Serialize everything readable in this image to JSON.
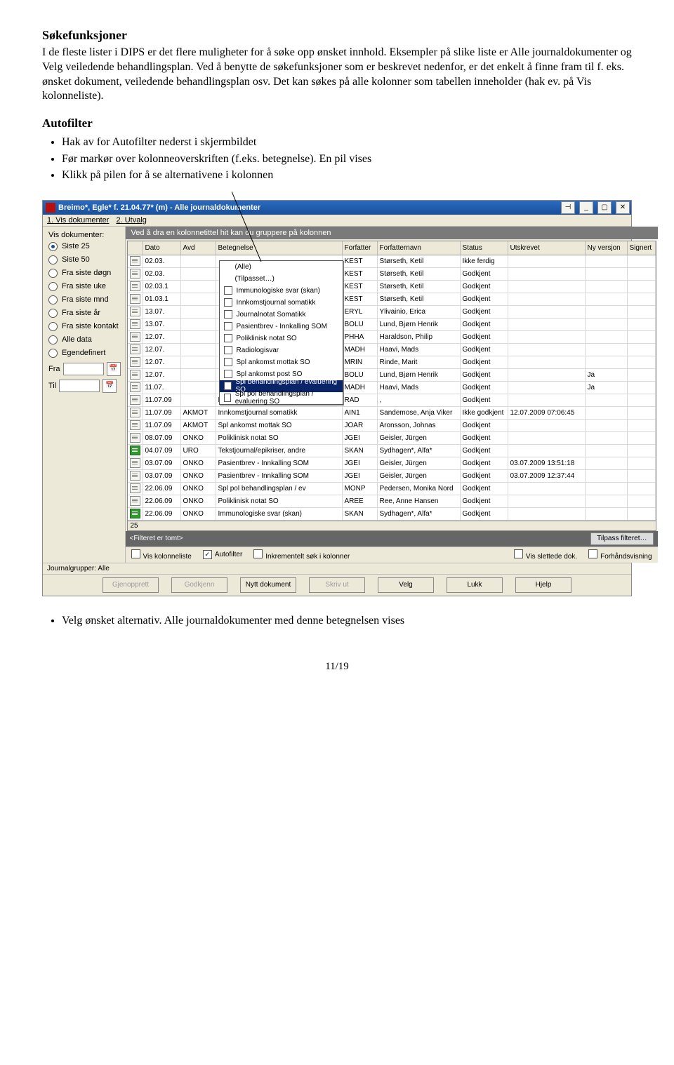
{
  "sec1": {
    "title": "Søkefunksjoner",
    "body": "I de fleste lister i DIPS er det flere muligheter for å søke opp ønsket innhold. Eksempler på slike liste er Alle journaldokumenter og Velg veiledende behandlingsplan. Ved å benytte de søkefunksjoner som er beskrevet nedenfor, er det enkelt å finne fram til f. eks. ønsket dokument, veiledende behandlingsplan osv. Det kan søkes på alle kolonner som tabellen inneholder (hak ev. på Vis kolonneliste)."
  },
  "sec2": {
    "title": "Autofilter",
    "bullets": [
      "Hak av for Autofilter nederst i skjermbildet",
      "Før markør over kolonneoverskriften (f.eks. betegnelse).  En pil vises",
      "Klikk på pilen for å se alternativene i kolonnen"
    ]
  },
  "window": {
    "title": "Breimo*, Egle* f. 21.04.77* (m) - Alle journaldokumenter",
    "strip1": "1. Vis dokumenter",
    "strip2": "2. Utvalg",
    "sidebarTitle": "Vis dokumenter:",
    "radios": [
      "Siste 25",
      "Siste 50",
      "Fra siste døgn",
      "Fra siste uke",
      "Fra siste mnd",
      "Fra siste år",
      "Fra siste kontakt",
      "Alle data",
      "Egendefinert"
    ],
    "fraLabel": "Fra",
    "tilLabel": "Til",
    "groupHint": "Ved å dra en kolonnetittel hit kan du gruppere på kolonnen",
    "columns": [
      "",
      "Dato",
      "Avd",
      "Betegnelse",
      "Forfatter",
      "Forfatternavn",
      "Status",
      "Utskrevet",
      "Ny versjon",
      "Signert"
    ],
    "rows": [
      {
        "ico": "doc",
        "d": "02.03.",
        "a": "",
        "b": "",
        "f": "KEST",
        "fn": "Størseth, Ketil",
        "s": "Ikke ferdig",
        "u": "",
        "nv": "",
        "sg": ""
      },
      {
        "ico": "doc",
        "d": "02.03.",
        "a": "",
        "b": "",
        "f": "KEST",
        "fn": "Størseth, Ketil",
        "s": "Godkjent",
        "u": "",
        "nv": "",
        "sg": ""
      },
      {
        "ico": "doc",
        "d": "02.03.1",
        "a": "",
        "b": "",
        "f": "KEST",
        "fn": "Størseth, Ketil",
        "s": "Godkjent",
        "u": "",
        "nv": "",
        "sg": ""
      },
      {
        "ico": "doc",
        "d": "01.03.1",
        "a": "",
        "b": "",
        "f": "KEST",
        "fn": "Størseth, Ketil",
        "s": "Godkjent",
        "u": "",
        "nv": "",
        "sg": ""
      },
      {
        "ico": "doc",
        "d": "13.07.",
        "a": "",
        "b": "",
        "f": "ERYL",
        "fn": "Ylivainio, Erica",
        "s": "Godkjent",
        "u": "",
        "nv": "",
        "sg": ""
      },
      {
        "ico": "doc",
        "d": "13.07.",
        "a": "",
        "b": "",
        "f": "BOLU",
        "fn": "Lund, Bjørn Henrik",
        "s": "Godkjent",
        "u": "",
        "nv": "",
        "sg": ""
      },
      {
        "ico": "doc",
        "d": "12.07.",
        "a": "",
        "b": "",
        "f": "PHHA",
        "fn": "Haraldson, Philip",
        "s": "Godkjent",
        "u": "",
        "nv": "",
        "sg": ""
      },
      {
        "ico": "doc",
        "d": "12.07.",
        "a": "",
        "b": "",
        "f": "MADH",
        "fn": "Haavi, Mads",
        "s": "Godkjent",
        "u": "",
        "nv": "",
        "sg": ""
      },
      {
        "ico": "doc",
        "d": "12.07.",
        "a": "",
        "b": "",
        "f": "MRIN",
        "fn": "Rinde, Marit",
        "s": "Godkjent",
        "u": "",
        "nv": "",
        "sg": ""
      },
      {
        "ico": "doc",
        "d": "12.07.",
        "a": "",
        "b": "",
        "f": "BOLU",
        "fn": "Lund, Bjørn Henrik",
        "s": "Godkjent",
        "u": "",
        "nv": "Ja",
        "sg": ""
      },
      {
        "ico": "doc",
        "d": "11.07.",
        "a": "",
        "b": "",
        "f": "MADH",
        "fn": "Haavi, Mads",
        "s": "Godkjent",
        "u": "",
        "nv": "Ja",
        "sg": ""
      },
      {
        "ico": "doc",
        "d": "11.07.09",
        "a": "",
        "b": "Radiologisvar",
        "f": "RAD",
        "fn": ",",
        "s": "Godkjent",
        "u": "",
        "nv": "",
        "sg": ""
      },
      {
        "ico": "doc",
        "d": "11.07.09",
        "a": "AKMOT",
        "b": "Innkomstjournal somatikk",
        "f": "AIN1",
        "fn": "Sandemose, Anja Viker",
        "s": "Ikke godkjent",
        "u": "12.07.2009 07:06:45",
        "nv": "",
        "sg": ""
      },
      {
        "ico": "doc",
        "d": "11.07.09",
        "a": "AKMOT",
        "b": "Spl ankomst mottak SO",
        "f": "JOAR",
        "fn": "Aronsson, Johnas",
        "s": "Godkjent",
        "u": "",
        "nv": "",
        "sg": ""
      },
      {
        "ico": "doc",
        "d": "08.07.09",
        "a": "ONKO",
        "b": "Poliklinisk notat SO",
        "f": "JGEI",
        "fn": "Geisler, Jürgen",
        "s": "Godkjent",
        "u": "",
        "nv": "",
        "sg": ""
      },
      {
        "ico": "green",
        "d": "04.07.09",
        "a": "URO",
        "b": "Tekstjournal/epikriser, andre",
        "f": "SKAN",
        "fn": "Sydhagen*, Alfa*",
        "s": "Godkjent",
        "u": "",
        "nv": "",
        "sg": ""
      },
      {
        "ico": "doc",
        "d": "03.07.09",
        "a": "ONKO",
        "b": "Pasientbrev - Innkalling SOM",
        "f": "JGEI",
        "fn": "Geisler, Jürgen",
        "s": "Godkjent",
        "u": "03.07.2009 13:51:18",
        "nv": "",
        "sg": ""
      },
      {
        "ico": "doc",
        "d": "03.07.09",
        "a": "ONKO",
        "b": "Pasientbrev - Innkalling SOM",
        "f": "JGEI",
        "fn": "Geisler, Jürgen",
        "s": "Godkjent",
        "u": "03.07.2009 12:37:44",
        "nv": "",
        "sg": ""
      },
      {
        "ico": "doc",
        "d": "22.06.09",
        "a": "ONKO",
        "b": "Spl pol behandlingsplan / ev",
        "f": "MONP",
        "fn": "Pedersen, Monika Nord",
        "s": "Godkjent",
        "u": "",
        "nv": "",
        "sg": ""
      },
      {
        "ico": "doc",
        "d": "22.06.09",
        "a": "ONKO",
        "b": "Poliklinisk notat SO",
        "f": "AREE",
        "fn": "Ree, Anne Hansen",
        "s": "Godkjent",
        "u": "",
        "nv": "",
        "sg": ""
      },
      {
        "ico": "green",
        "d": "22.06.09",
        "a": "ONKO",
        "b": "Immunologiske svar (skan)",
        "f": "SKAN",
        "fn": "Sydhagen*, Alfa*",
        "s": "Godkjent",
        "u": "",
        "nv": "",
        "sg": ""
      }
    ],
    "rowCount": "25",
    "afOptions": [
      {
        "t": "(Alle)",
        "sel": false,
        "chk": false
      },
      {
        "t": "(Tilpasset…)",
        "sel": false,
        "chk": false
      },
      {
        "t": "Immunologiske svar (skan)",
        "sel": false,
        "chk": true
      },
      {
        "t": "Innkomstjournal somatikk",
        "sel": false,
        "chk": true
      },
      {
        "t": "Journalnotat Somatikk",
        "sel": false,
        "chk": true
      },
      {
        "t": "Pasientbrev - Innkalling SOM",
        "sel": false,
        "chk": true
      },
      {
        "t": "Poliklinisk notat SO",
        "sel": false,
        "chk": true
      },
      {
        "t": "Radiologisvar",
        "sel": false,
        "chk": true
      },
      {
        "t": "Spl ankomst mottak SO",
        "sel": false,
        "chk": true
      },
      {
        "t": "Spl ankomst post SO",
        "sel": false,
        "chk": true
      },
      {
        "t": "Spl behandlingsplan / evaluering SO",
        "sel": true,
        "chk": true
      },
      {
        "t": "Spl pol behandlingsplan / evaluering SO",
        "sel": false,
        "chk": true
      }
    ],
    "filterEmpty": "<Filteret er tomt>",
    "filterCustom": "Tilpass filteret…",
    "chkVisKol": "Vis kolonneliste",
    "chkAutofilter": "Autofilter",
    "chkInkr": "Inkrementelt søk i kolonner",
    "chkVisSlett": "Vis slettede dok.",
    "chkForhand": "Forhåndsvisning",
    "journalgrupper": "Journalgrupper: Alle",
    "btns": {
      "gjenopprett": "Gjenopprett",
      "godkjenn": "Godkjenn",
      "nytt": "Nytt dokument",
      "skriv": "Skriv ut",
      "velg": "Velg",
      "lukk": "Lukk",
      "hjelp": "Hjelp"
    }
  },
  "sec3": {
    "bullets": [
      "Velg ønsket alternativ.  Alle journaldokumenter med denne betegnelsen vises"
    ]
  },
  "pageNum": "11/19"
}
